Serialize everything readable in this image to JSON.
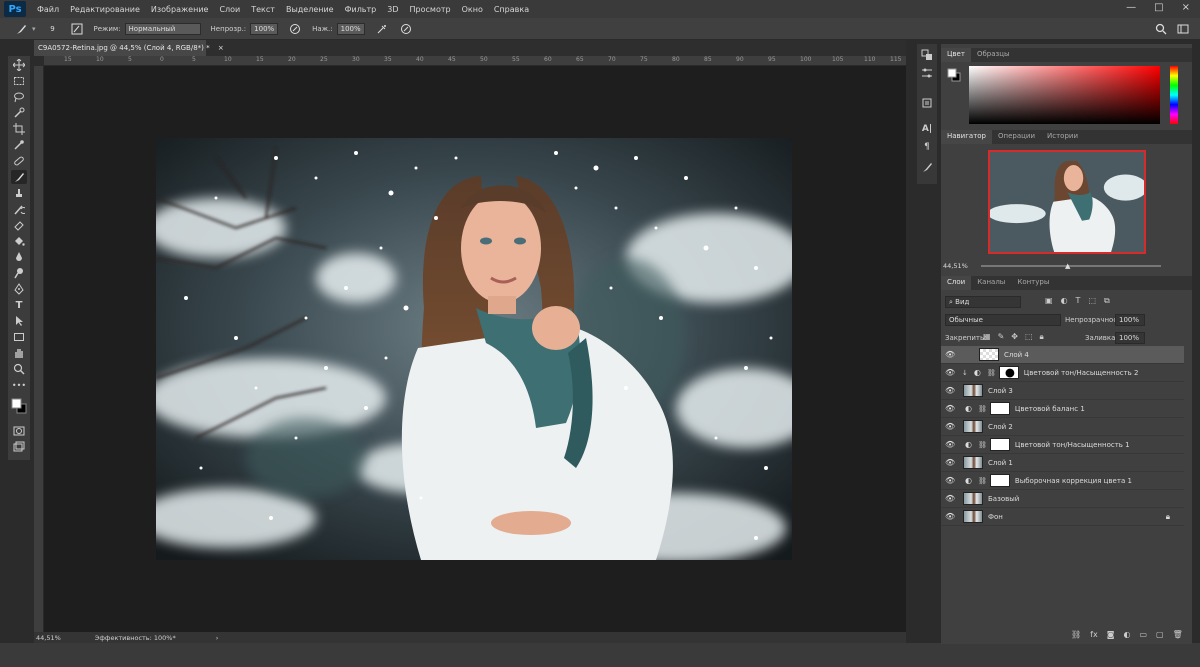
{
  "menubar": {
    "logo": "Ps",
    "items": [
      "Файл",
      "Редактирование",
      "Изображение",
      "Слои",
      "Текст",
      "Выделение",
      "Фильтр",
      "3D",
      "Просмотр",
      "Окно",
      "Справка"
    ],
    "win_controls": [
      "—",
      "□",
      "×"
    ]
  },
  "options": {
    "brush_size": "9",
    "mode_label": "Режим:",
    "mode_value": "Нормальный",
    "opacity_label": "Непрозр.:",
    "opacity_value": "100%",
    "flow_label": "Наж.:",
    "flow_value": "100%"
  },
  "document": {
    "tab_title": "C9A0572-Retina.jpg @ 44,5% (Слой 4, RGB/8*) *",
    "close": "×",
    "zoom": "44,51%",
    "efficiency": "Эффективность: 100%*",
    "ruler_marks": [
      "15",
      "10",
      "5",
      "0",
      "5",
      "10",
      "15",
      "20",
      "25",
      "30",
      "35",
      "40",
      "45",
      "50",
      "55",
      "60",
      "65",
      "70",
      "75",
      "80",
      "85",
      "90",
      "95",
      "100",
      "105",
      "110",
      "115"
    ]
  },
  "color_panel": {
    "tabs": [
      "Цвет",
      "Образцы"
    ],
    "foreground": "#ffffff",
    "background": "#000000",
    "hue": "#ff0000"
  },
  "navigator": {
    "tabs": [
      "Навигатор",
      "Операции",
      "Истории"
    ],
    "zoom": "44,51%"
  },
  "layers_panel": {
    "tabs": [
      "Слои",
      "Каналы",
      "Контуры"
    ],
    "filter_label": "Вид",
    "blend_mode": "Обычные",
    "opacity_label": "Непрозрачность:",
    "opacity_value": "100%",
    "lock_label": "Закрепить:",
    "fill_label": "Заливка:",
    "fill_value": "100%",
    "layers": [
      {
        "name": "Слой 4",
        "kind": "pixel-snow",
        "selected": true
      },
      {
        "name": "Цветовой тон/Насыщенность 2",
        "kind": "adjustment-mask",
        "selected": false
      },
      {
        "name": "Слой 3",
        "kind": "pixel",
        "selected": false
      },
      {
        "name": "Цветовой баланс 1",
        "kind": "adjustment",
        "selected": false
      },
      {
        "name": "Слой 2",
        "kind": "pixel",
        "selected": false
      },
      {
        "name": "Цветовой тон/Насыщенность 1",
        "kind": "adjustment",
        "selected": false
      },
      {
        "name": "Слой 1",
        "kind": "pixel",
        "selected": false
      },
      {
        "name": "Выборочная коррекция цвета 1",
        "kind": "adjustment",
        "selected": false
      },
      {
        "name": "Базовый",
        "kind": "pixel",
        "selected": false
      },
      {
        "name": "Фон",
        "kind": "background",
        "selected": false
      }
    ],
    "footer_icons": [
      "link-icon",
      "fx-icon",
      "mask-icon",
      "adjustment-icon",
      "folder-icon",
      "new-layer-icon",
      "trash-icon"
    ]
  }
}
